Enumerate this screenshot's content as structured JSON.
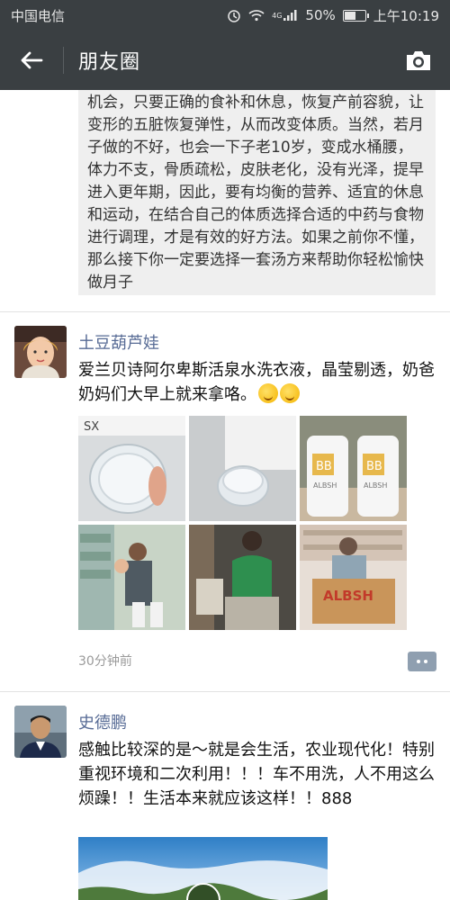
{
  "status_bar": {
    "carrier": "中国电信",
    "network": "4G",
    "battery": "50%",
    "battery_level": 0.5,
    "time": "上午10:19"
  },
  "nav": {
    "title": "朋友圈"
  },
  "feed": {
    "shared_text": "机会，只要正确的食补和休息，恢复产前容貌，让变形的五脏恢复弹性，从而改变体质。当然，若月子做的不好，也会一下子老10岁，变成水桶腰，体力不支，骨质疏松，皮肤老化，没有光泽，提早进入更年期，因此，要有均衡的营养、适宜的休息和运动，在结合自己的体质选择合适的中药与食物进行调理，才是有效的好方法。如果之前你不懂，那么接下你一定要选择一套汤方来帮助你轻松愉快做月子",
    "posts": [
      {
        "author": "土豆葫芦娃",
        "text": "爱兰贝诗阿尔卑斯活泉水洗衣液，晶莹剔透，奶爸奶妈们大早上就来拿咯。",
        "emoji": [
          "grinning-sweat-emoji",
          "grinning-sweat-emoji"
        ],
        "photos": [
          {
            "label": "SX",
            "kind": "detergent-cap-closeup"
          },
          {
            "label": "",
            "kind": "detergent-cap-transparent"
          },
          {
            "label": "ALBSH",
            "kind": "two-detergent-bottles"
          },
          {
            "label": "",
            "kind": "customer-holding-child"
          },
          {
            "label": "",
            "kind": "customer-green-shirt"
          },
          {
            "label": "ALBSH",
            "kind": "customer-with-box"
          }
        ],
        "time": "30分钟前"
      },
      {
        "author": "史德鹏",
        "text": "感触比较深的是～就是会生活，农业现代化！特别重视环境和二次利用！！！车不用洗，人不用这么烦躁！！生活本来就应该这样！！888"
      }
    ]
  }
}
